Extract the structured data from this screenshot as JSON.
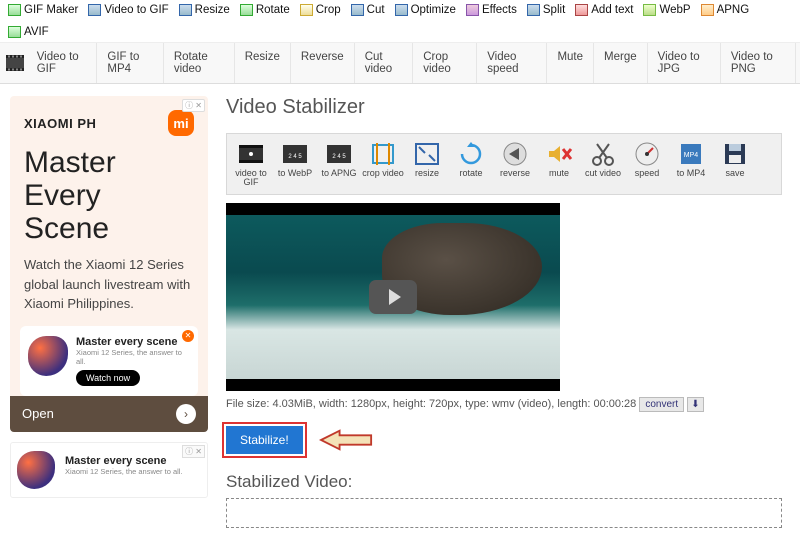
{
  "topnav": [
    {
      "label": "GIF Maker",
      "icon": "g"
    },
    {
      "label": "Video to GIF",
      "icon": "b"
    },
    {
      "label": "Resize",
      "icon": "b"
    },
    {
      "label": "Rotate",
      "icon": "g"
    },
    {
      "label": "Crop",
      "icon": "y"
    },
    {
      "label": "Cut",
      "icon": "b"
    },
    {
      "label": "Optimize",
      "icon": "b"
    },
    {
      "label": "Effects",
      "icon": "p"
    },
    {
      "label": "Split",
      "icon": "b"
    },
    {
      "label": "Add text",
      "icon": "r"
    },
    {
      "label": "WebP",
      "icon": "lg"
    },
    {
      "label": "APNG",
      "icon": "o"
    },
    {
      "label": "AVIF",
      "icon": "g"
    }
  ],
  "subnav": [
    "Video to GIF",
    "GIF to MP4",
    "Rotate video",
    "Resize",
    "Reverse",
    "Cut video",
    "Crop video",
    "Video speed",
    "Mute",
    "Merge",
    "Video to JPG",
    "Video to PNG"
  ],
  "page_title": "Video Stabilizer",
  "tools": [
    {
      "label": "video to GIF",
      "name": "video-to-gif"
    },
    {
      "label": "to WebP",
      "name": "to-webp"
    },
    {
      "label": "to APNG",
      "name": "to-apng"
    },
    {
      "label": "crop video",
      "name": "crop-video"
    },
    {
      "label": "resize",
      "name": "resize"
    },
    {
      "label": "rotate",
      "name": "rotate"
    },
    {
      "label": "reverse",
      "name": "reverse"
    },
    {
      "label": "mute",
      "name": "mute"
    },
    {
      "label": "cut video",
      "name": "cut-video"
    },
    {
      "label": "speed",
      "name": "speed"
    },
    {
      "label": "to MP4",
      "name": "to-mp4"
    },
    {
      "label": "save",
      "name": "save"
    }
  ],
  "file_info": {
    "text": "File size: 4.03MiB, width: 1280px, height: 720px, type: wmv (video), length: 00:00:28",
    "convert": "convert",
    "download": "⬇"
  },
  "stabilize_label": "Stabilize!",
  "stabilized_heading": "Stabilized Video:",
  "ad1": {
    "close": "ⓘ ✕",
    "brand": "XIAOMI PH",
    "logo": "mi",
    "title": "Master Every Scene",
    "desc": "Watch the Xiaomi 12 Series global launch livestream with Xiaomi Philippines.",
    "card_title": "Master every scene",
    "card_sub": "Xiaomi 12 Series, the answer to all.",
    "watch": "Watch now",
    "open": "Open",
    "arrow": "›"
  },
  "ad2": {
    "close": "ⓘ ✕",
    "title": "Master every scene",
    "sub": "Xiaomi 12 Series, the answer to all."
  }
}
